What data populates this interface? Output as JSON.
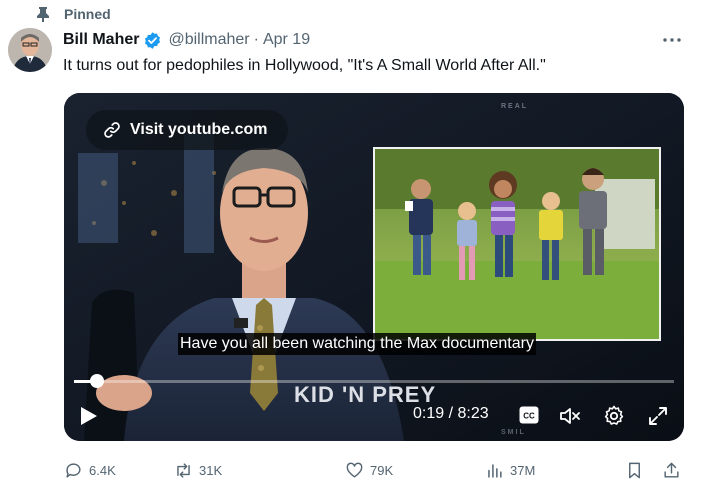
{
  "pinned": {
    "label": "Pinned"
  },
  "author": {
    "name": "Bill Maher",
    "handle": "@billmaher",
    "separator": "·",
    "date": "Apr 19"
  },
  "tweet": {
    "text": "It turns out for pedophiles in Hollywood, \"It's A Small World After All.\""
  },
  "video": {
    "link_label": "Visit youtube.com",
    "caption": "Have you all been watching the Max documentary",
    "lower_third": "KID 'N PREY",
    "overlay_mark_top": "REAL",
    "overlay_mark_bottom": "SMIL",
    "time": "0:19 / 8:23",
    "progress": 0.038,
    "cc_label": "CC"
  },
  "actions": {
    "replies": "6.4K",
    "reposts": "31K",
    "likes": "79K",
    "views": "37M"
  },
  "icons": {
    "pin": "pin-icon",
    "verified": "verified-badge-icon",
    "more": "more-icon",
    "link": "link-icon",
    "play": "play-icon",
    "captions": "captions-icon",
    "mute": "mute-icon",
    "settings": "gear-icon",
    "fullscreen": "fullscreen-icon",
    "reply": "reply-icon",
    "repost": "repost-icon",
    "like": "heart-icon",
    "views": "views-icon",
    "bookmark": "bookmark-icon",
    "share": "share-icon"
  },
  "colors": {
    "text_primary": "#0f1419",
    "text_secondary": "#536471",
    "verified_blue": "#1d9bf0",
    "video_bg": "#0c1118"
  }
}
